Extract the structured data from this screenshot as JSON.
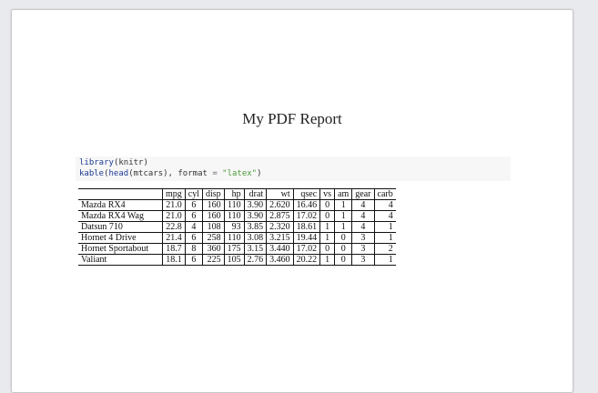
{
  "document": {
    "title": "My PDF Report"
  },
  "code": {
    "line1_fn": "library",
    "line1_arg": "(knitr)",
    "line2_fn1": "kable",
    "line2_p1": "(",
    "line2_fn2": "head",
    "line2_p2": "(mtcars), ",
    "line2_kw": "format",
    "line2_eq": " = ",
    "line2_str": "\"latex\"",
    "line2_p3": ")"
  },
  "table": {
    "headers": [
      "",
      "mpg",
      "cyl",
      "disp",
      "hp",
      "drat",
      "wt",
      "qsec",
      "vs",
      "am",
      "gear",
      "carb"
    ],
    "rows": [
      [
        "Mazda RX4",
        "21.0",
        "6",
        "160",
        "110",
        "3.90",
        "2.620",
        "16.46",
        "0",
        "1",
        "4",
        "4"
      ],
      [
        "Mazda RX4 Wag",
        "21.0",
        "6",
        "160",
        "110",
        "3.90",
        "2.875",
        "17.02",
        "0",
        "1",
        "4",
        "4"
      ],
      [
        "Datsun 710",
        "22.8",
        "4",
        "108",
        "93",
        "3.85",
        "2.320",
        "18.61",
        "1",
        "1",
        "4",
        "1"
      ],
      [
        "Hornet 4 Drive",
        "21.4",
        "6",
        "258",
        "110",
        "3.08",
        "3.215",
        "19.44",
        "1",
        "0",
        "3",
        "1"
      ],
      [
        "Hornet Sportabout",
        "18.7",
        "8",
        "360",
        "175",
        "3.15",
        "3.440",
        "17.02",
        "0",
        "0",
        "3",
        "2"
      ],
      [
        "Valiant",
        "18.1",
        "6",
        "225",
        "105",
        "2.76",
        "3.460",
        "20.22",
        "1",
        "0",
        "3",
        "1"
      ]
    ]
  }
}
